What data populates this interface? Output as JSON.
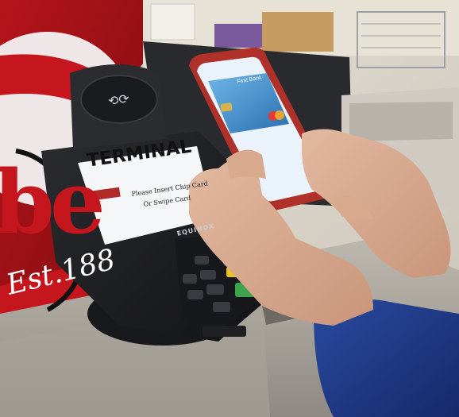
{
  "terminal": {
    "header": "TERMINAL",
    "button_label": "",
    "prompt_line1": "Please Insert Chip Card",
    "prompt_line2": "Or Swipe Card",
    "brand": "EQUINOX"
  },
  "sign": {
    "letters": "be",
    "est": "Est.188"
  },
  "phone_card": {
    "bank": "First Bank"
  },
  "colors": {
    "sign_red": "#c4161c",
    "terminal_body": "#1e1f22",
    "screen_white": "#f4f6f8",
    "sleeve_blue": "#1f3a8a",
    "phone_case_red": "#b0302a",
    "card_blue": "#2a7fc1",
    "key_yellow": "#e9c21f",
    "key_green": "#3fa34d",
    "key_red": "#c0392b"
  },
  "icons": [
    "contactless-icon",
    "card-chip-icon",
    "mastercard-logo"
  ]
}
